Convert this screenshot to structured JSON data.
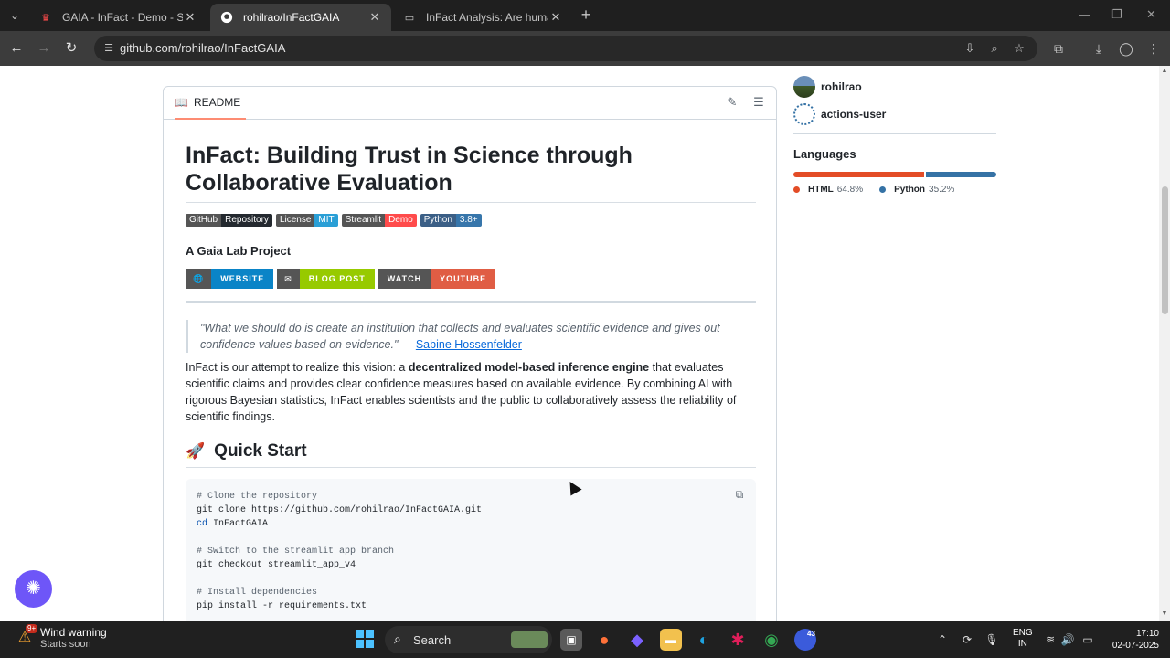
{
  "browser": {
    "tabs": [
      {
        "title": "GAIA - InFact - Demo - Streamlit",
        "active": false,
        "favicon": "streamlit-crown-icon"
      },
      {
        "title": "rohilrao/InFactGAIA",
        "active": true,
        "favicon": "github-icon"
      },
      {
        "title": "InFact Analysis: Are human-gen",
        "active": false,
        "favicon": "document-icon"
      }
    ],
    "url": "github.com/rohilrao/InFactGAIA"
  },
  "readme": {
    "tab_label": "README",
    "title": "InFact: Building Trust in Science through Collaborative Evaluation",
    "badges": [
      {
        "label": "GitHub",
        "value": "Repository",
        "color": "#24292f"
      },
      {
        "label": "License",
        "value": "MIT",
        "color": "#2a9fd6"
      },
      {
        "label": "Streamlit",
        "value": "Demo",
        "color": "#ff4b4b"
      },
      {
        "label": "Python",
        "value": "3.8+",
        "color": "#3776ab"
      }
    ],
    "subtitle": "A Gaia Lab Project",
    "link_badges": [
      {
        "label": "WEBSITE",
        "color": "#0a84c7"
      },
      {
        "label": "BLOG POST",
        "color": "#97ca00"
      },
      {
        "label": "WATCH",
        "color": "#555555"
      },
      {
        "label": "YOUTUBE",
        "color": "#e05d44"
      }
    ],
    "quote_text": "\"What we should do is create an institution that collects and evaluates scientific evidence and gives out confidence values based on evidence.\" — ",
    "quote_author": "Sabine Hossenfelder",
    "para_start": "InFact is our attempt to realize this vision: a ",
    "para_bold": "decentralized model-based inference engine",
    "para_end": " that evaluates scientific claims and provides clear confidence measures based on available evidence. By combining AI with rigorous Bayesian statistics, InFact enables scientists and the public to collaboratively assess the reliability of scientific findings.",
    "quickstart_heading": "Quick Start",
    "code": {
      "c1": "# Clone the repository",
      "l1": "git clone https://github.com/rohilrao/InFactGAIA.git",
      "l2_kw": "cd",
      "l2_rest": " InFactGAIA",
      "c2": "# Switch to the streamlit app branch",
      "l3": "git checkout streamlit_app_v4",
      "c3": "# Install dependencies",
      "l4": "pip install -r requirements.txt"
    }
  },
  "sidebar": {
    "contributors": [
      "rohilrao",
      "actions-user"
    ],
    "languages_heading": "Languages",
    "languages": [
      {
        "name": "HTML",
        "percent": "64.8%",
        "share": 64.8,
        "color": "#e34c26"
      },
      {
        "name": "Python",
        "percent": "35.2%",
        "share": 35.2,
        "color": "#3572a5"
      }
    ]
  },
  "taskbar": {
    "weather_title": "Wind warning",
    "weather_sub": "Starts soon",
    "weather_badge": "9+",
    "search_label": "Search",
    "app_badge": "43",
    "lang_line1": "ENG",
    "lang_line2": "IN",
    "time": "17:10",
    "date": "02-07-2025"
  }
}
